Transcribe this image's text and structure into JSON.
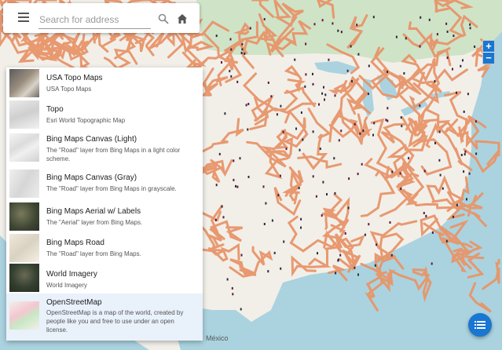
{
  "search": {
    "placeholder": "Search for address",
    "menu_icon": "hamburger-menu-icon",
    "search_icon": "search-icon",
    "home_icon": "home-icon"
  },
  "zoom": {
    "in_label": "+",
    "out_label": "−"
  },
  "basemaps": [
    {
      "title": "USA Topo Maps",
      "description": "USA Topo Maps",
      "thumb": "usa-topo-thumbnail"
    },
    {
      "title": "Topo",
      "description": "Esri World Topographic Map",
      "thumb": "topo-thumbnail"
    },
    {
      "title": "Bing Maps Canvas (Light)",
      "description": "The \"Road\" layer from Bing Maps in a light color scheme.",
      "thumb": "bing-light-thumbnail"
    },
    {
      "title": "Bing Maps Canvas (Gray)",
      "description": "The \"Road\" layer from Bing Maps in grayscale.",
      "thumb": "bing-gray-thumbnail"
    },
    {
      "title": "Bing Maps Aerial w/ Labels",
      "description": "The \"Aerial\" layer from Bing Maps.",
      "thumb": "bing-aerial-thumbnail"
    },
    {
      "title": "Bing Maps Road",
      "description": "The \"Road\" layer from Bing Maps.",
      "thumb": "bing-road-thumbnail"
    },
    {
      "title": "World Imagery",
      "description": "World Imagery",
      "thumb": "world-imagery-thumbnail"
    },
    {
      "title": "OpenStreetMap",
      "description": "OpenStreetMap is a map of the world, created by people like you and free to use under an open license.",
      "thumb": "openstreetmap-thumbnail",
      "selected": true
    }
  ],
  "map_labels": {
    "mexico": "México"
  },
  "fab": {
    "icon": "list-icon"
  },
  "colors": {
    "accent": "#1976d2",
    "water": "#aad3df",
    "land": "#f2efe9",
    "route": "#e8956a",
    "selected": "#e9f1fb"
  }
}
